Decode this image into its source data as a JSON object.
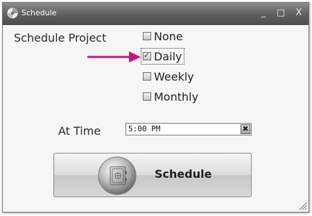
{
  "window": {
    "title": "Schedule",
    "controls": {
      "minimize": "_",
      "maximize": "□",
      "close": "X"
    }
  },
  "form": {
    "schedule_project_label": "Schedule Project",
    "options": [
      {
        "label": "None",
        "checked": false
      },
      {
        "label": "Daily",
        "checked": true,
        "focused": true
      },
      {
        "label": "Weekly",
        "checked": false
      },
      {
        "label": "Monthly",
        "checked": false
      }
    ],
    "at_time_label": "At Time",
    "time_value": "5:00 PM",
    "time_clear_glyph": "✖",
    "check_glyph": "✓"
  },
  "action": {
    "schedule_button_label": "Schedule"
  },
  "colors": {
    "annotation_arrow": "#c0187a"
  },
  "icons": {
    "title": "app-logo-icon",
    "button": "safe-vault-icon",
    "resize": "resize-grip-icon"
  }
}
